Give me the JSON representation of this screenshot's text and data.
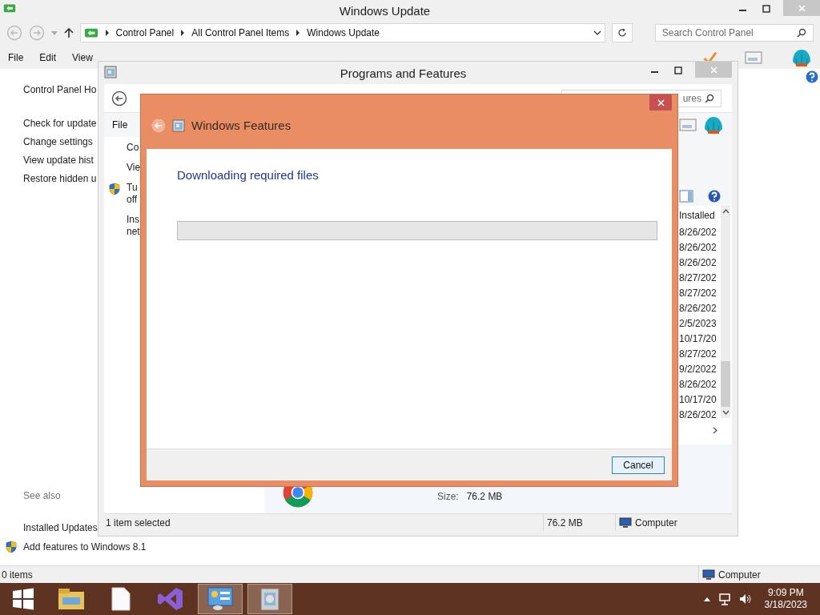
{
  "main_window": {
    "title": "Windows Update",
    "breadcrumb": [
      "Control Panel",
      "All Control Panel Items",
      "Windows Update"
    ],
    "search": {
      "placeholder": "Search Control Panel"
    },
    "menu": [
      "File",
      "Edit",
      "View"
    ],
    "home_link": "Control Panel Ho",
    "nav_links": [
      "Check for update",
      "Change settings",
      "View update hist",
      "Restore hidden u"
    ],
    "see_also": {
      "heading": "See also",
      "links": [
        {
          "label": "Installed Updates",
          "kind": "plain"
        },
        {
          "label": "Add features to Windows 8.1",
          "kind": "shield"
        }
      ]
    },
    "status_bar": {
      "items": "0 items",
      "location": "Computer"
    }
  },
  "programs_window": {
    "title": "Programs and Features",
    "search": {
      "placeholder": "ures"
    },
    "menu": [
      "File"
    ],
    "side_items": [
      {
        "kind": "plain",
        "lines": [
          "Co"
        ]
      },
      {
        "kind": "plain",
        "lines": [
          "Vie"
        ]
      },
      {
        "kind": "shield",
        "lines": [
          "Tu",
          "off"
        ]
      },
      {
        "kind": "plain",
        "lines": [
          "Ins",
          "net"
        ]
      }
    ],
    "column_header": "Installed",
    "dates": [
      "8/26/202",
      "8/26/202",
      "8/26/202",
      "8/27/202",
      "8/27/202",
      "8/26/202",
      "2/5/2023",
      "10/17/20",
      "8/27/202",
      "9/2/2022",
      "8/26/202",
      "10/17/20",
      "8/26/202"
    ],
    "details": {
      "label": "Size:",
      "value": "76.2 MB"
    },
    "status_bar": {
      "selection": "1 item selected",
      "size": "76.2 MB",
      "location": "Computer"
    }
  },
  "dialog": {
    "title": "Windows Features",
    "heading": "Downloading required files",
    "progress": {
      "level": 0
    },
    "buttons": [
      "Cancel"
    ]
  },
  "taskbar": {
    "apps": [
      {
        "kind": "explorer",
        "selected": false
      },
      {
        "kind": "file",
        "selected": false
      },
      {
        "kind": "studio",
        "selected": false
      },
      {
        "kind": "control",
        "selected": true
      },
      {
        "kind": "installer",
        "selected": true
      }
    ],
    "time": "9:09 PM",
    "date": "3/18/2023"
  }
}
